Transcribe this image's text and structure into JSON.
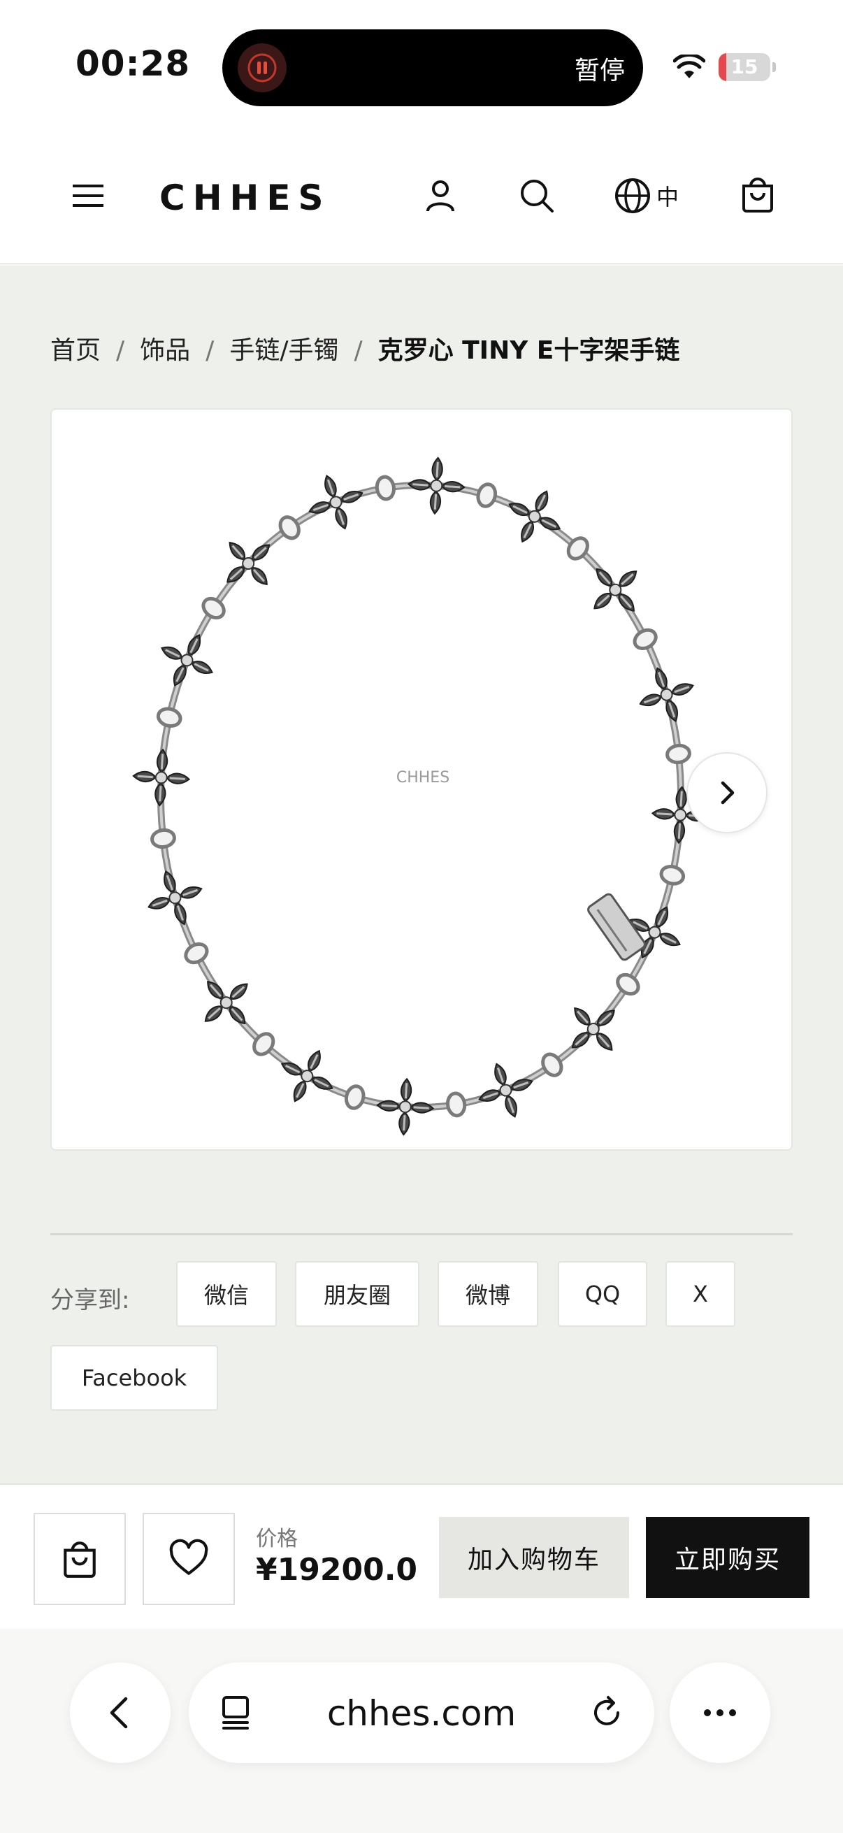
{
  "status_bar": {
    "time": "00:28",
    "recording_label": "暂停",
    "battery_level": 15,
    "battery_text": "15"
  },
  "header": {
    "brand": "CHHES",
    "language": "中"
  },
  "breadcrumb": {
    "items": [
      "首页",
      "饰品",
      "手链/手镯"
    ],
    "separator": "/",
    "current": "克罗心 TINY E十字架手链"
  },
  "gallery": {
    "watermark": "CHHES",
    "image_subject": "silver cross-link bracelet"
  },
  "share": {
    "label": "分享到:",
    "buttons": [
      "微信",
      "朋友圈",
      "微博",
      "QQ",
      "X",
      "Facebook"
    ]
  },
  "purchase": {
    "price_label": "价格",
    "price": "¥19200.0",
    "add_to_cart": "加入购物车",
    "buy_now": "立即购买"
  },
  "browser": {
    "url": "chhes.com"
  },
  "colors": {
    "page_bg": "#eef0eb",
    "primary_button": "#111111",
    "secondary_button": "#e6e7e2",
    "battery_low": "#e5484d"
  }
}
